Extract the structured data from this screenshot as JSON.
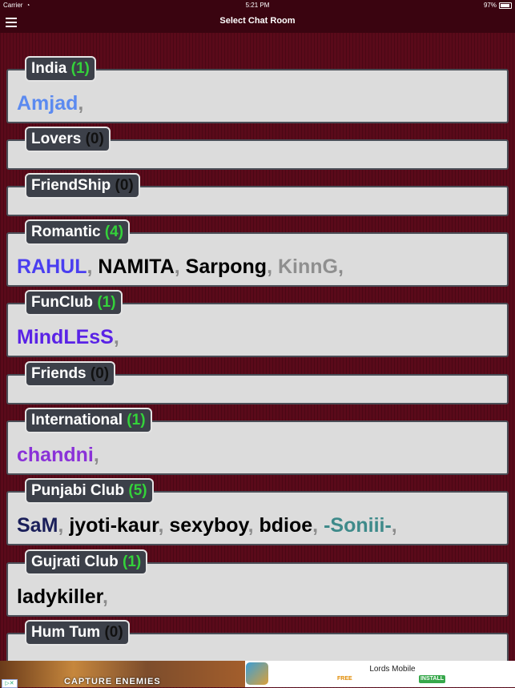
{
  "status_bar": {
    "carrier": "Carrier",
    "time": "5:21 PM",
    "battery": "97%"
  },
  "navbar": {
    "title": "Select Chat Room"
  },
  "rooms": [
    {
      "name": "India ",
      "count": "(1)",
      "count_color": "green",
      "users": [
        {
          "name": "Amjad",
          "color": "#5b8af0"
        }
      ]
    },
    {
      "name": "Lovers ",
      "count": "(0)",
      "count_color": "dark",
      "users": []
    },
    {
      "name": "FriendShip ",
      "count": "(0)",
      "count_color": "dark",
      "users": []
    },
    {
      "name": "Romantic ",
      "count": "(4)",
      "count_color": "green",
      "users": [
        {
          "name": "RAHUL",
          "color": "#4a3ef0"
        },
        {
          "name": "NAMITA",
          "color": "#000000"
        },
        {
          "name": "Sarpong",
          "color": "#000000"
        },
        {
          "name": "KinnG",
          "color": "#8f8f8f"
        }
      ]
    },
    {
      "name": "FunClub ",
      "count": "(1)",
      "count_color": "green",
      "users": [
        {
          "name": "MindLEsS",
          "color": "#5a23e6"
        }
      ]
    },
    {
      "name": "Friends ",
      "count": "(0)",
      "count_color": "dark",
      "users": []
    },
    {
      "name": "International ",
      "count": "(1)",
      "count_color": "green",
      "users": [
        {
          "name": "chandni",
          "color": "#8a32d8"
        }
      ]
    },
    {
      "name": "Punjabi Club ",
      "count": "(5)",
      "count_color": "green",
      "users": [
        {
          "name": "SaM",
          "color": "#1a1f5a"
        },
        {
          "name": "jyoti-kaur",
          "color": "#000000"
        },
        {
          "name": "sexyboy",
          "color": "#000000"
        },
        {
          "name": "bdioe",
          "color": "#000000"
        },
        {
          "name": "-Soniii-",
          "color": "#3e8a8a"
        }
      ]
    },
    {
      "name": "Gujrati Club ",
      "count": "(1)",
      "count_color": "green",
      "users": [
        {
          "name": "ladykiller",
          "color": "#000000"
        }
      ]
    },
    {
      "name": "Hum Tum ",
      "count": "(0)",
      "count_color": "dark",
      "users": []
    }
  ],
  "separator": ",",
  "ad": {
    "banner_text": "CAPTURE ENEMIES",
    "app_name": "Lords Mobile",
    "price": "FREE",
    "install_label": "INSTALL"
  }
}
